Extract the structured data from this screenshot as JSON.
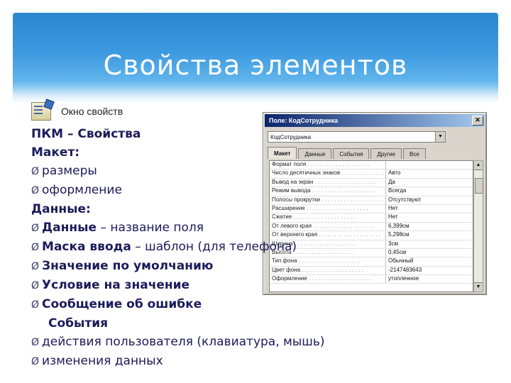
{
  "slide": {
    "title": "Свойства элементов",
    "menu_item_label": "Окно свойств"
  },
  "bullets": [
    {
      "text": "ПКМ – Свойства",
      "bold": true,
      "arrow": false,
      "indent": false
    },
    {
      "text": "Макет:",
      "bold": true,
      "arrow": false,
      "indent": false
    },
    {
      "text": "размеры",
      "bold": false,
      "arrow": true,
      "indent": false
    },
    {
      "text": "оформление",
      "bold": false,
      "arrow": true,
      "indent": false
    },
    {
      "text": "Данные:",
      "bold": true,
      "arrow": false,
      "indent": false
    },
    {
      "text_bold": "Данные",
      "text": " – название поля",
      "arrow": true,
      "indent": false
    },
    {
      "text_bold": "Маска ввода",
      "text": " – шаблон (для телефона)",
      "arrow": true,
      "indent": false
    },
    {
      "text_bold": "Значение по умолчанию",
      "text": "",
      "arrow": true,
      "indent": false
    },
    {
      "text_bold": "Условие на значение",
      "text": "",
      "arrow": true,
      "indent": false
    },
    {
      "text_bold": "Сообщение об ошибке",
      "text": "",
      "arrow": true,
      "indent": false
    },
    {
      "text": "События",
      "bold": true,
      "arrow": false,
      "indent": true
    },
    {
      "text": "действия пользователя (клавиатура, мышь)",
      "bold": false,
      "arrow": true,
      "indent": false
    },
    {
      "text": "изменения данных",
      "bold": false,
      "arrow": true,
      "indent": false
    }
  ],
  "dialog": {
    "title": "Поле: КодСотрудника",
    "combo_value": "КодСотрудника",
    "tabs": [
      "Макет",
      "Данные",
      "События",
      "Другие",
      "Все"
    ],
    "active_tab": "Макет",
    "properties": [
      {
        "key": "Формат поля",
        "value": ""
      },
      {
        "key": "Число десятичных знаков",
        "value": "Авто"
      },
      {
        "key": "Вывод на экран",
        "value": "Да"
      },
      {
        "key": "Режим вывода",
        "value": "Всегда"
      },
      {
        "key": "Полосы прокрутки",
        "value": "Отсутствуют"
      },
      {
        "key": "Расширение",
        "value": "Нет"
      },
      {
        "key": "Сжатие",
        "value": "Нет"
      },
      {
        "key": "От левого края",
        "value": "6,399см"
      },
      {
        "key": "От верхнего края",
        "value": "5,298см"
      },
      {
        "key": "Ширина",
        "value": "3см"
      },
      {
        "key": "Высота",
        "value": "0,45см"
      },
      {
        "key": "Тип фона",
        "value": "Обычный"
      },
      {
        "key": "Цвет фона",
        "value": "-2147483643"
      },
      {
        "key": "Оформление",
        "value": "утопленное"
      }
    ]
  },
  "colors": {
    "header_blue": "#2a86cf",
    "text_navy": "#1b1b5a",
    "dialog_gray": "#d9d5cc",
    "titlebar_navy": "#0a246a"
  }
}
